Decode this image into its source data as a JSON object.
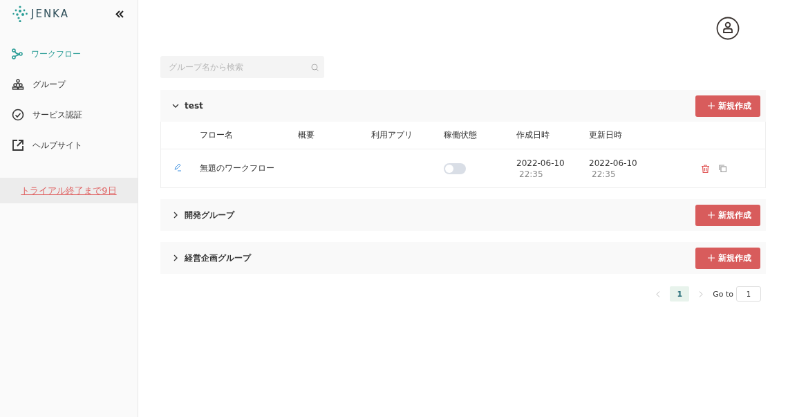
{
  "logo": {
    "text": "JENKA"
  },
  "nav": [
    {
      "label": "ワークフロー",
      "selected": true
    },
    {
      "label": "グループ",
      "selected": false
    },
    {
      "label": "サービス認証",
      "selected": false
    },
    {
      "label": "ヘルプサイト",
      "selected": false
    }
  ],
  "trial_link": "トライアル終了まで9日",
  "search": {
    "placeholder": "グループ名から検索"
  },
  "groups": [
    {
      "name": "test",
      "expanded": true,
      "button": "新規作成",
      "table": {
        "columns": [
          "フロー名",
          "概要",
          "利用アプリ",
          "稼働状態",
          "作成日時",
          "更新日時"
        ],
        "rows": [
          {
            "flow_name": "無題のワークフロー",
            "running": false,
            "created_date": "2022-06-10",
            "created_time": "22:35",
            "updated_date": "2022-06-10",
            "updated_time": "22:35"
          }
        ]
      }
    },
    {
      "name": "開発グループ",
      "expanded": false,
      "button": "新規作成"
    },
    {
      "name": "経営企画グループ",
      "expanded": false,
      "button": "新規作成"
    }
  ],
  "pagination": {
    "pages": [
      {
        "label": "1",
        "selected": true
      }
    ],
    "goto_label": "Go to",
    "goto_value": "1"
  }
}
